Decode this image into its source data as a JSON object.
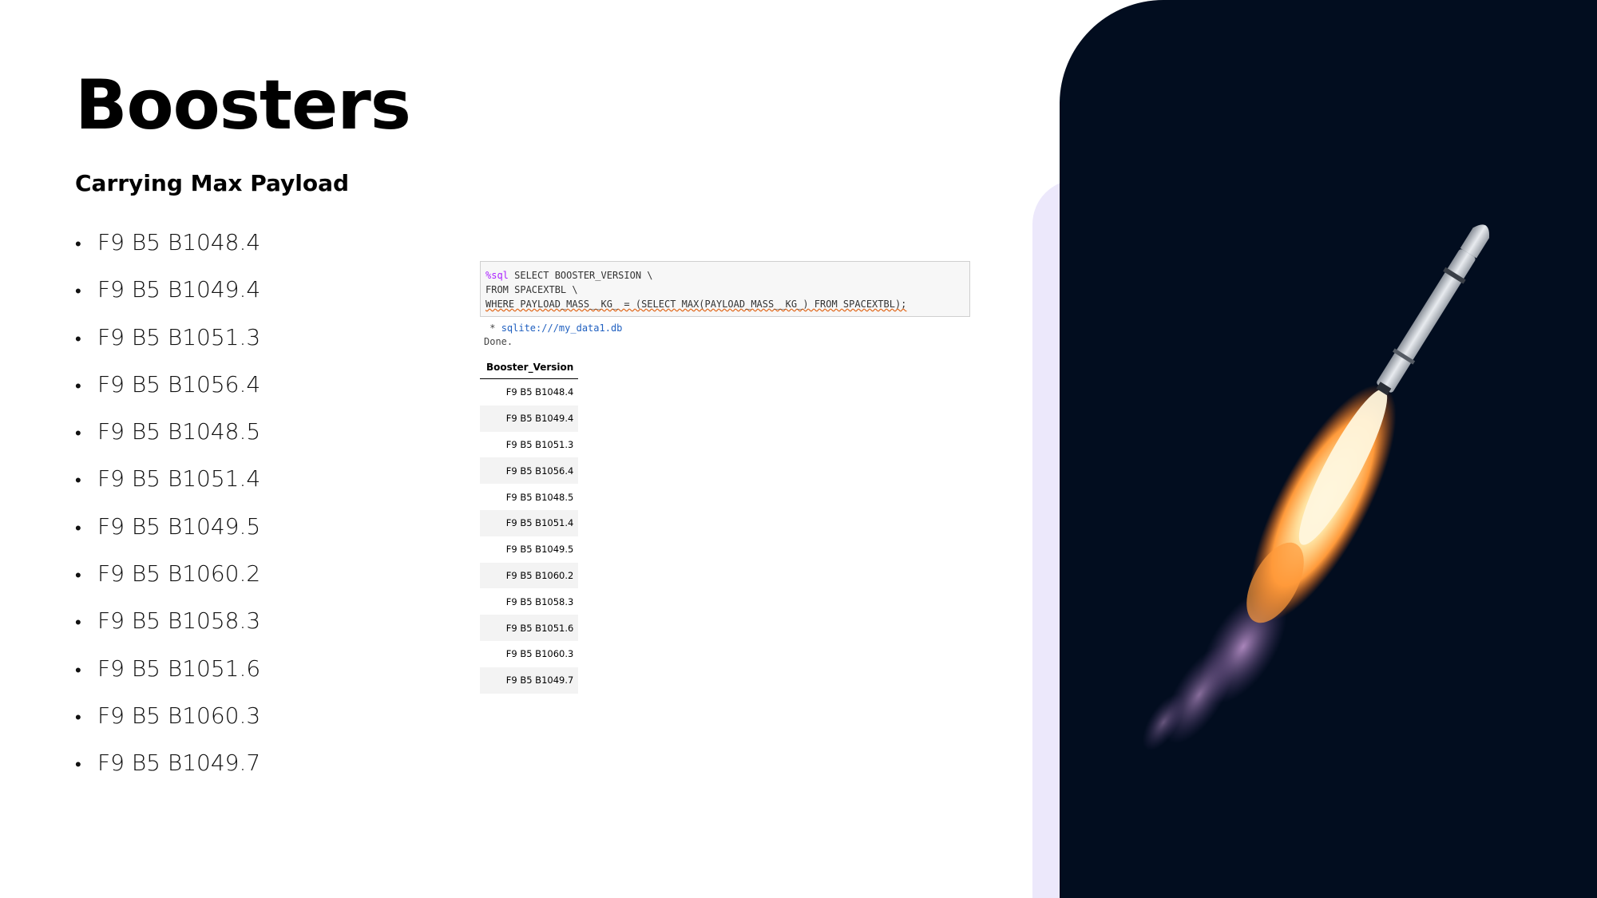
{
  "title": "Boosters",
  "subtitle": "Carrying Max Payload",
  "bullet_symbol": "•",
  "boosters": [
    "F9 B5 B1048.4",
    "F9 B5 B1049.4",
    "F9 B5 B1051.3",
    "F9 B5 B1056.4",
    "F9 B5 B1048.5",
    "F9 B5 B1051.4",
    "F9 B5 B1049.5",
    "F9 B5 B1060.2",
    "F9 B5 B1058.3",
    "F9 B5 B1051.6",
    "F9 B5 B1060.3",
    "F9 B5 B1049.7"
  ],
  "notebook": {
    "code_magic": "%sql",
    "code_line1_rest": " SELECT BOOSTER_VERSION \\",
    "code_line2": "FROM SPACEXTBL \\",
    "code_line3": "WHERE PAYLOAD_MASS__KG_ = (SELECT MAX(PAYLOAD_MASS__KG_) FROM SPACEXTBL);",
    "output_prefix": " * ",
    "output_conn": "sqlite:///my_data1.db",
    "output_done": "Done.",
    "table_header": "Booster_Version"
  },
  "colors": {
    "background": "#ffffff",
    "lavender_panel": "#ece8fb",
    "photo_background": "#020d1f",
    "sql_magic": "#aa22ff",
    "connection_link": "#2060c0",
    "squiggle": "#e06a1e"
  }
}
